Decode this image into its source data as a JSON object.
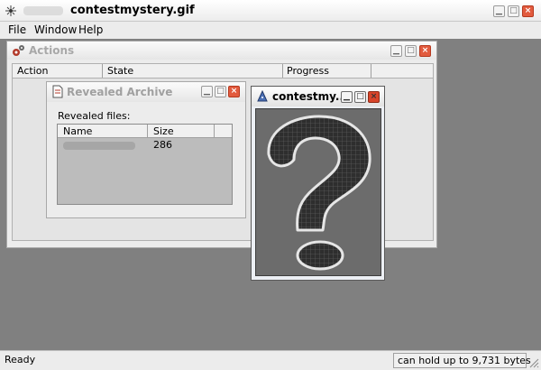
{
  "main_window": {
    "title": "contestmystery.gif",
    "app_icon": "sparkle-icon",
    "menu": [
      {
        "label": "File"
      },
      {
        "label": "Window"
      },
      {
        "label": "Help"
      }
    ]
  },
  "actions_window": {
    "title": "Actions",
    "icon": "gears-icon",
    "columns": [
      {
        "label": "Action"
      },
      {
        "label": "State"
      },
      {
        "label": "Progress"
      }
    ]
  },
  "archive_window": {
    "title": "Revealed Archive",
    "icon": "document-icon",
    "label": "Revealed files:",
    "columns": [
      {
        "label": "Name"
      },
      {
        "label": "Size"
      }
    ],
    "rows": [
      {
        "size": "286"
      }
    ]
  },
  "image_window": {
    "title": "contestmy...",
    "icon": "wizard-icon",
    "image": "question-mark-glyph"
  },
  "status_bar": {
    "left": "Ready",
    "right": "can hold up to 9,731 bytes"
  },
  "colors": {
    "workspace": "#808080",
    "close_button": "#e25b3e",
    "image_background": "#6c6c6c"
  }
}
